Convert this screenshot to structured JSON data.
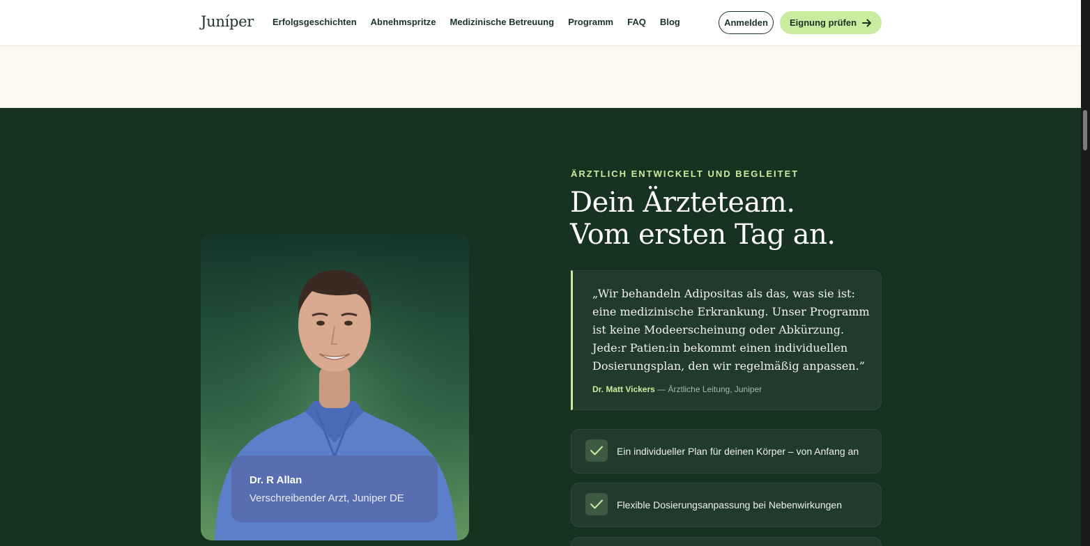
{
  "header": {
    "logo": "Juníper",
    "nav": [
      "Erfolgsgeschichten",
      "Abnehmspritze",
      "Medizinische Betreuung",
      "Programm",
      "FAQ",
      "Blog"
    ],
    "login_label": "Anmelden",
    "cta_label": "Eignung prüfen"
  },
  "doctor_card": {
    "name": "Dr. R Allan",
    "role": "Verschreibender Arzt, Juniper DE"
  },
  "section": {
    "eyebrow": "ÄRZTLICH ENTWICKELT UND BEGLEITET",
    "headline_line1": "Dein Ärzteteam.",
    "headline_line2": "Vom ersten Tag an.",
    "quote": "„Wir behandeln Adipositas als das, was sie ist: eine medizinische Erkrankung. Unser Programm ist keine Modeerscheinung oder Abkürzung. Jede:r Patien:in bekommt einen individuellen Dosierungsplan, den wir regelmäßig anpassen.”",
    "quote_author": "Dr. Matt Vickers",
    "quote_author_role": " — Ärztliche Leitung, Juniper",
    "features": [
      "Ein individueller Plan für deinen Körper – von Anfang an",
      "Flexible Dosierungsanpassung bei Nebenwirkungen"
    ]
  },
  "colors": {
    "brand_dark": "#183222",
    "accent_lime": "#c9ec9f",
    "cream": "#fdf9f1"
  }
}
